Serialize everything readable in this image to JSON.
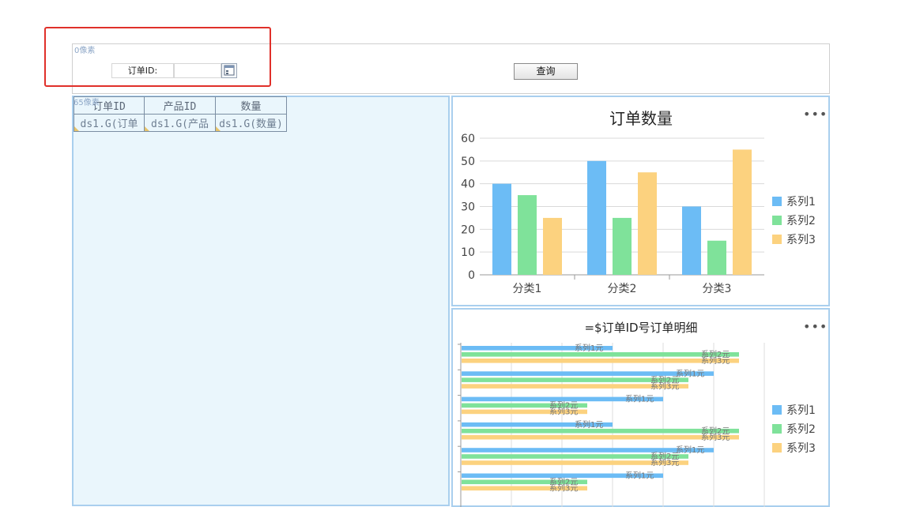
{
  "param_panel": {
    "hint": "0像素",
    "order_label": "订单ID:",
    "order_value": "",
    "query_label": "查询"
  },
  "report": {
    "hint": "65像素",
    "headers": [
      "订单ID",
      "产品ID",
      "数量"
    ],
    "cells": [
      "ds1.G(订单",
      "ds1.G(产品",
      "ds1.G(数量)"
    ]
  },
  "colors": {
    "series1": "#6cbcf5",
    "series2": "#7fe29a",
    "series3": "#fcd27f",
    "highlight": "#e0302a"
  },
  "charts": {
    "chart1_more": "•••",
    "chart2_more": "•••"
  },
  "chart_data": [
    {
      "type": "bar",
      "title": "订单数量",
      "categories": [
        "分类1",
        "分类2",
        "分类3"
      ],
      "series": [
        {
          "name": "系列1",
          "values": [
            40,
            50,
            30
          ]
        },
        {
          "name": "系列2",
          "values": [
            35,
            25,
            15
          ]
        },
        {
          "name": "系列3",
          "values": [
            25,
            45,
            55
          ]
        }
      ],
      "ylim": [
        0,
        60
      ],
      "yticks": [
        0,
        10,
        20,
        30,
        40,
        50,
        60
      ],
      "grid": true,
      "legend": "right"
    },
    {
      "type": "bar",
      "orientation": "horizontal",
      "title": "=$订单ID号订单明细",
      "groups": 6,
      "series": [
        {
          "name": "系列1",
          "values": [
            30,
            50,
            40,
            30,
            50,
            40
          ],
          "label": "系列1元"
        },
        {
          "name": "系列2",
          "values": [
            55,
            45,
            25,
            55,
            45,
            25
          ],
          "label": "系列2元"
        },
        {
          "name": "系列3",
          "values": [
            55,
            45,
            25,
            55,
            45,
            25
          ],
          "label": "系列3元"
        }
      ],
      "xlim": [
        0,
        60
      ],
      "xticks": [
        0,
        10,
        20,
        30,
        40,
        50,
        60
      ],
      "grid": true,
      "legend": "right"
    }
  ]
}
